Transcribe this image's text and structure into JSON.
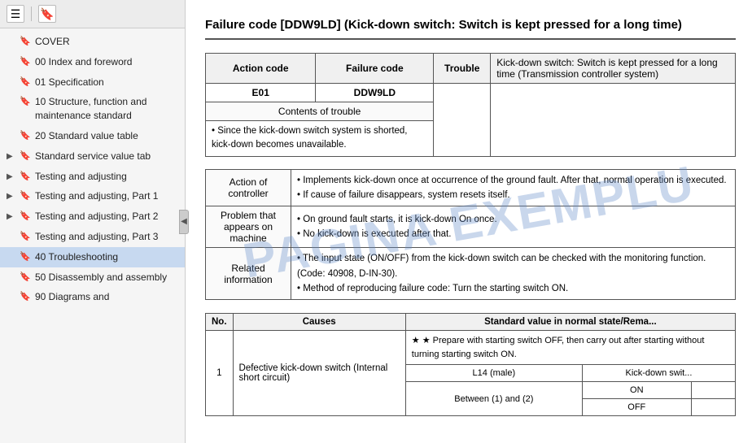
{
  "toolbar": {
    "icon1": "☰",
    "icon2": "🔖"
  },
  "sidebar": {
    "items": [
      {
        "id": "cover",
        "label": "COVER",
        "expandable": false,
        "indent": 0
      },
      {
        "id": "00-index",
        "label": "00 Index and foreword",
        "expandable": false,
        "indent": 0
      },
      {
        "id": "01-spec",
        "label": "01 Specification",
        "expandable": false,
        "indent": 0
      },
      {
        "id": "10-structure",
        "label": "10 Structure, function and maintenance standard",
        "expandable": false,
        "indent": 0
      },
      {
        "id": "20-standard",
        "label": "20 Standard value table",
        "expandable": false,
        "indent": 0
      },
      {
        "id": "std-service",
        "label": "Standard service value tab",
        "expandable": true,
        "indent": 0
      },
      {
        "id": "testing-adj",
        "label": "Testing and adjusting",
        "expandable": true,
        "indent": 0
      },
      {
        "id": "testing-adj-1",
        "label": "Testing and adjusting, Part 1",
        "expandable": true,
        "indent": 0
      },
      {
        "id": "testing-adj-2",
        "label": "Testing and adjusting, Part 2",
        "expandable": true,
        "indent": 0
      },
      {
        "id": "testing-adj-3",
        "label": "Testing and adjusting, Part 3",
        "expandable": false,
        "indent": 0
      },
      {
        "id": "40-trouble",
        "label": "40 Troubleshooting",
        "expandable": false,
        "indent": 0,
        "active": true
      },
      {
        "id": "50-disassembly",
        "label": "50 Disassembly and assembly",
        "expandable": false,
        "indent": 0
      },
      {
        "id": "90-diagrams",
        "label": "90 Diagrams and",
        "expandable": false,
        "indent": 0
      }
    ]
  },
  "main": {
    "title": "Failure code [DDW9LD] (Kick-down switch: Switch is kept pressed for a long time)",
    "title_short": "Failure code [DDW9LD] (Kick-down switch: Switch is ke...\nlong time)",
    "table1": {
      "col_action_code": "Action code",
      "col_failure_code": "Failure code",
      "col_trouble": "Trouble",
      "col_desc": "Kick-down switch: Switch is kept pressed for a long time (Transmission controller system)",
      "action_code_val": "E01",
      "failure_code_val": "DDW9LD",
      "row_contents": {
        "label": "Contents of trouble",
        "content": "• Since the kick-down switch system is shorted, kick-down becomes unavailable."
      },
      "row_action": {
        "label": "Action of controller",
        "content": "• Implements kick-down once at occurrence of the ground fault. After that, normal operation is executed.\n• If cause of failure disappears, system resets itself."
      },
      "row_problem": {
        "label": "Problem that appears on machine",
        "content": "• On ground fault starts, it is kick-down On once.\n• No kick-down is executed after that."
      },
      "row_related": {
        "label": "Related information",
        "content_1": "• The input state (ON/OFF) from the kick-down switch can be checked with the monitoring function. (Code: 40908, D-IN-30).",
        "content_2": "• Method of reproducing failure code: Turn the starting switch ON."
      }
    },
    "table2": {
      "col_no": "No.",
      "col_causes": "Causes",
      "col_standard": "Standard value in normal state/Rema...",
      "row1": {
        "no": "1",
        "cause": "Defective kick-down switch (Internal short circuit)",
        "sub_label1": "L14 (male)",
        "sub_label2": "Kick-down swit...",
        "sub_label3": "Between (1) and (2)",
        "sub_label4": "ON",
        "sub_label5": "OFF",
        "prepare": "★ Prepare with starting switch OFF, then carry out after starting without turning starting switch ON."
      }
    },
    "watermark": "PAGINA EXEMPLU"
  }
}
